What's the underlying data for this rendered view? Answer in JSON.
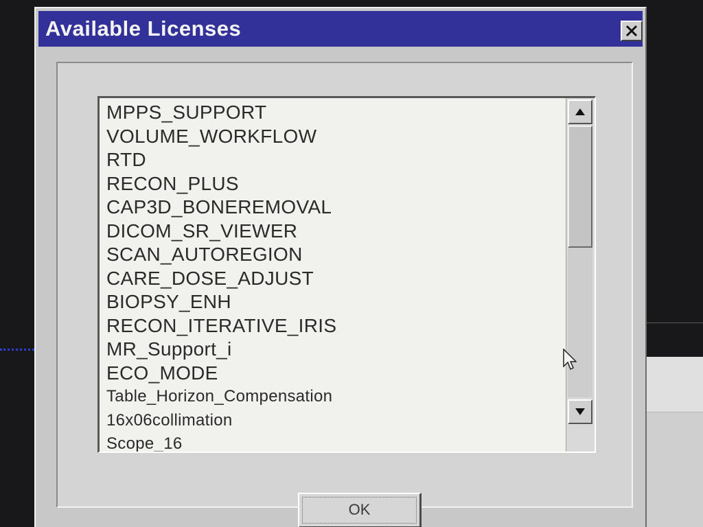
{
  "dialog": {
    "title": "Available Licenses",
    "close_icon": "close-x-icon"
  },
  "licenses": {
    "items": [
      "MPPS_SUPPORT",
      "VOLUME_WORKFLOW",
      "RTD",
      "RECON_PLUS",
      "CAP3D_BONEREMOVAL",
      "DICOM_SR_VIEWER",
      "SCAN_AUTOREGION",
      "CARE_DOSE_ADJUST",
      "BIOPSY_ENH",
      "RECON_ITERATIVE_IRIS",
      "MR_Support_i",
      "ECO_MODE",
      "Table_Horizon_Compensation",
      "16x06collimation",
      "Scope_16"
    ]
  },
  "scrollbar": {
    "up_icon": "arrow-up-icon",
    "down_icon": "arrow-down-icon"
  },
  "buttons": {
    "ok_label": "OK"
  },
  "colors": {
    "titlebar": "#32319a",
    "dialog_bg": "#c8c8c8",
    "list_bg": "#f1f1ee"
  }
}
